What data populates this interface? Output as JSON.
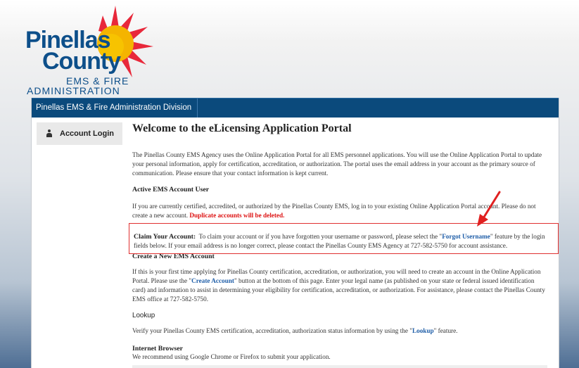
{
  "logo": {
    "line1": "Pinellas",
    "line2": "County",
    "line3": "EMS & FIRE",
    "line4": "ADMINISTRATION"
  },
  "navbar": {
    "item": "Pinellas EMS & Fire Administration Division"
  },
  "sidebar": {
    "items": [
      {
        "label": "Account Login",
        "icon": "user-icon"
      }
    ]
  },
  "main": {
    "title": "Welcome to the eLicensing Application Portal",
    "intro": "The Pinellas County EMS Agency uses the Online Application Portal for all EMS personnel applications. You will use the Online Application Portal to update your personal information, apply for certification, accreditation, or authorization. The portal uses the email address in your account as the primary source of communication. Please ensure that your contact information is kept current.",
    "active_heading": "Active EMS Account User",
    "active_text": "If you are currently certified, accredited, or authorized by the Pinellas County EMS, log in to your existing Online Application Portal account. Please do not create a new account.",
    "active_warning": "Duplicate accounts will be deleted.",
    "claim_heading": "Claim Your Account:",
    "claim_text_1": "To claim your account or if you have forgotten your username or password, please select the \"",
    "claim_link": "Forgot Username",
    "claim_text_2": "\" feature by the login fields below. If your email address is no longer correct, please contact the Pinellas County EMS Agency at 727-582-5750 for account assistance.",
    "create_heading": "Create a New EMS Account",
    "create_text_1": "If this is your first time applying for Pinellas County certification, accreditation, or authorization, you will need to create an account in the Online Application Portal. Please use the \"",
    "create_link": "Create Account",
    "create_text_2": "\" button at the bottom of this page. Enter your legal name (as published on your state or federal issued identification card) and information to assist in determining your eligibility for certification, accreditation, or authorization. For assistance, please contact the Pinellas County EMS office at 727-582-5750.",
    "lookup_heading": "Lookup",
    "lookup_text_1": "Verify your Pinellas County EMS certification, accreditation, authorization status information by using the \"",
    "lookup_link": "Lookup",
    "lookup_text_2": "\" feature.",
    "browser_heading": "Internet Browser",
    "browser_text": "We recommend using Google Chrome or Firefox to submit your application."
  },
  "colors": {
    "nav": "#0b4a7c",
    "logo_blue": "#0d4f8a",
    "highlight": "#e03030",
    "link": "#1f5ea8"
  }
}
